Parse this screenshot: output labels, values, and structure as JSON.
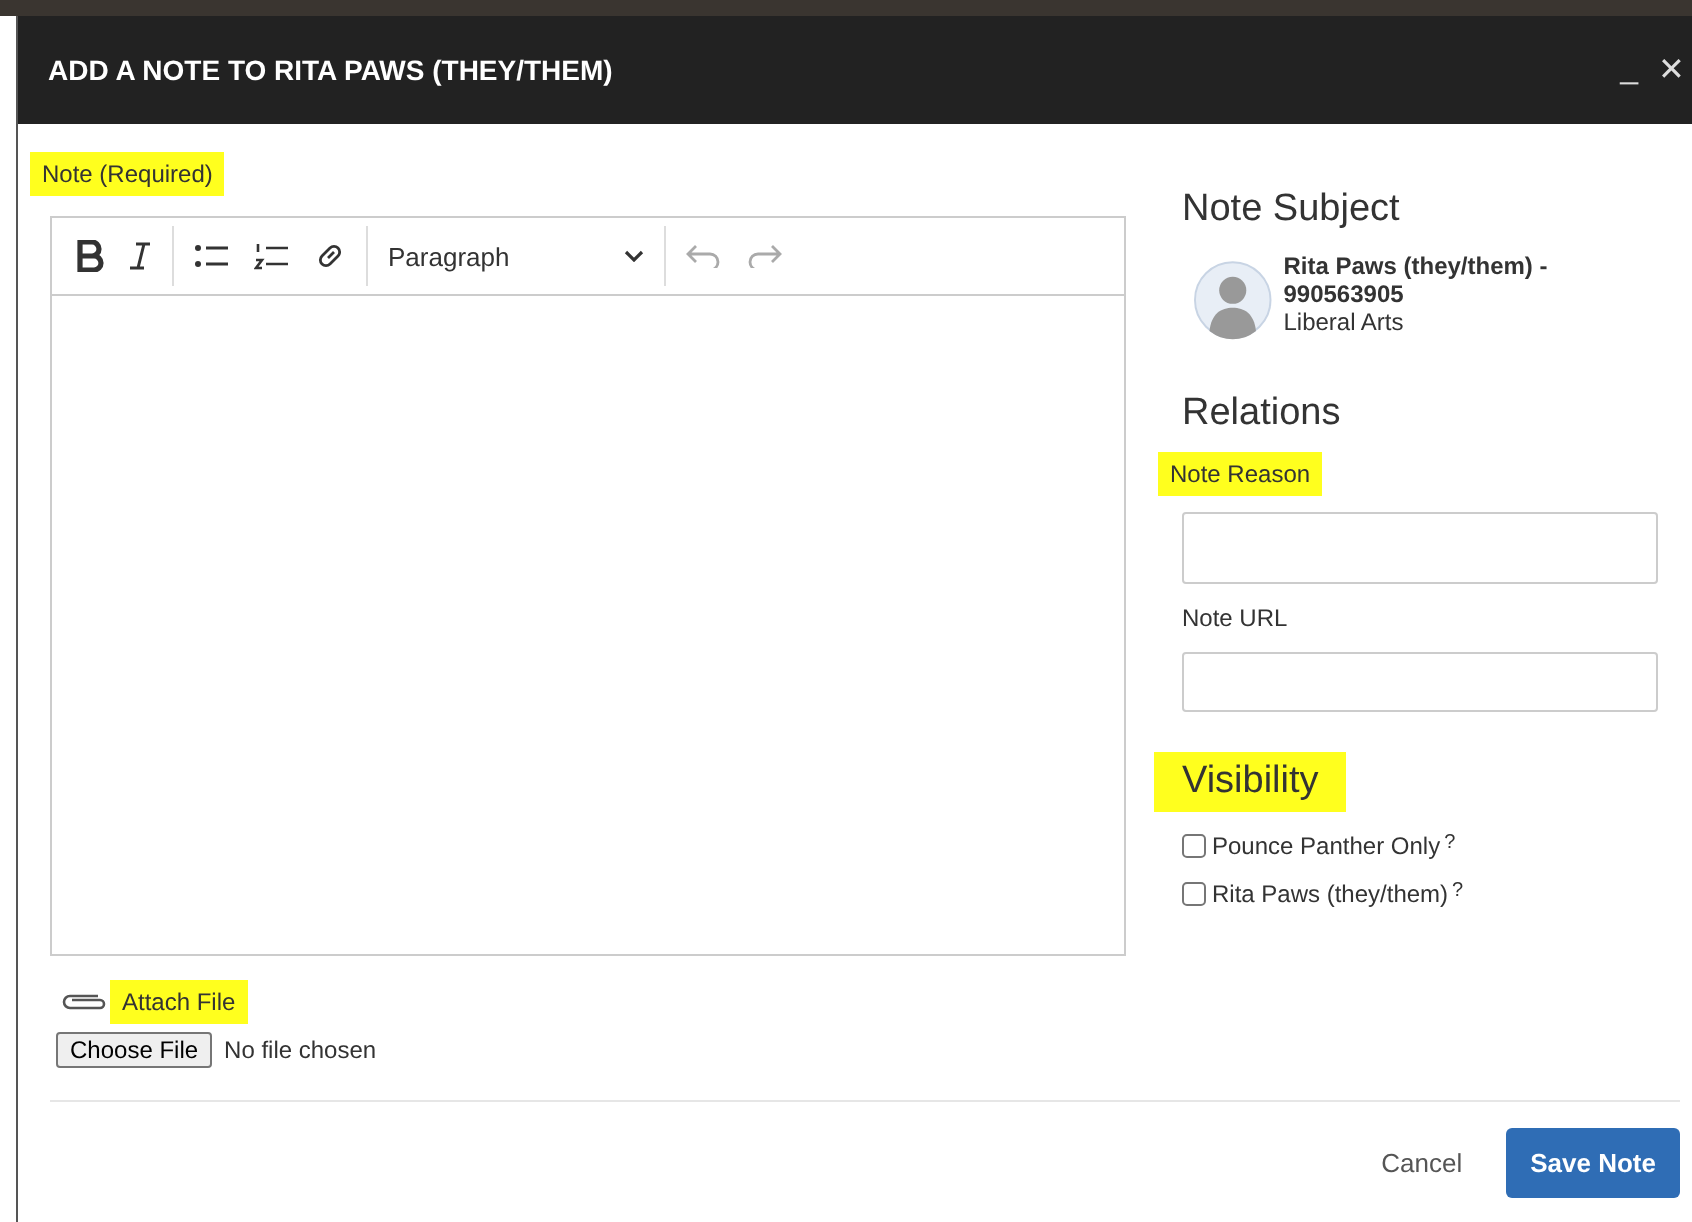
{
  "window": {
    "title": "ADD A NOTE TO RITA PAWS (THEY/THEM)",
    "controls": [
      "_",
      "✕"
    ]
  },
  "note": {
    "label": "Note (Required)",
    "highlighted": true,
    "toolbar": {
      "format": "Paragraph"
    }
  },
  "attachment": {
    "label": "Attach File",
    "highlighted": true,
    "button": "Choose File",
    "status": "No file chosen"
  },
  "subject": {
    "heading": "Note Subject",
    "name": "Rita Paws (they/them) - 990563905",
    "department": "Liberal Arts"
  },
  "relations": {
    "heading": "Relations",
    "fields": [
      {
        "label": "Note Reason",
        "highlighted": true
      },
      {
        "label": "Note URL",
        "highlighted": false
      }
    ]
  },
  "visibility": {
    "heading": "Visibility",
    "highlighted": true,
    "options": [
      {
        "label": "Pounce Panther Only",
        "help": "?",
        "checked": false
      },
      {
        "label": "Rita Paws (they/them)",
        "help": "?",
        "checked": false
      }
    ]
  },
  "buttons": {
    "cancel": "Cancel",
    "save": "Save Note"
  }
}
